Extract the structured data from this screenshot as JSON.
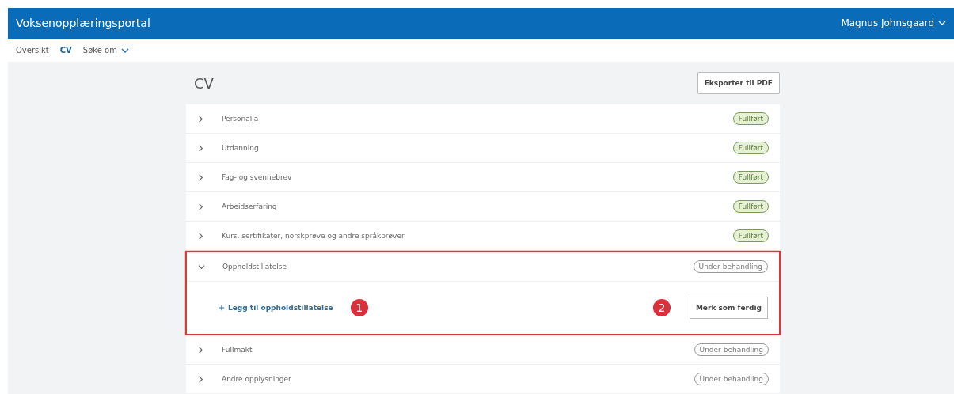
{
  "header": {
    "title": "Voksenopplæringsportal",
    "user": "Magnus Johnsgaard"
  },
  "nav": [
    {
      "label": "Oversikt",
      "selected": false,
      "dropdown": false
    },
    {
      "label": "CV",
      "selected": true,
      "dropdown": false
    },
    {
      "label": "Søke om",
      "selected": false,
      "dropdown": true
    }
  ],
  "page": {
    "title": "CV",
    "export_button": "Eksporter til PDF"
  },
  "sections": [
    {
      "label": "Personalia",
      "status": "Fullført",
      "kind": "done",
      "expanded": false,
      "highlighted": false
    },
    {
      "label": "Utdanning",
      "status": "Fullført",
      "kind": "done",
      "expanded": false,
      "highlighted": false
    },
    {
      "label": "Fag- og svennebrev",
      "status": "Fullført",
      "kind": "done",
      "expanded": false,
      "highlighted": false
    },
    {
      "label": "Arbeidserfaring",
      "status": "Fullført",
      "kind": "done",
      "expanded": false,
      "highlighted": false
    },
    {
      "label": "Kurs, sertifikater, norskprøve og andre språkprøver",
      "status": "Fullført",
      "kind": "done",
      "expanded": false,
      "highlighted": false
    },
    {
      "label": "Oppholdstillatelse",
      "status": "Under behandling",
      "kind": "pending",
      "expanded": true,
      "highlighted": true,
      "add_link": "Legg til oppholdstillatelse",
      "add_marker": "1",
      "button": "Merk som ferdig",
      "button_marker": "2"
    },
    {
      "label": "Fullmakt",
      "status": "Under behandling",
      "kind": "pending",
      "expanded": false,
      "highlighted": false
    },
    {
      "label": "Andre opplysninger",
      "status": "Under behandling",
      "kind": "pending",
      "expanded": false,
      "highlighted": false
    }
  ]
}
